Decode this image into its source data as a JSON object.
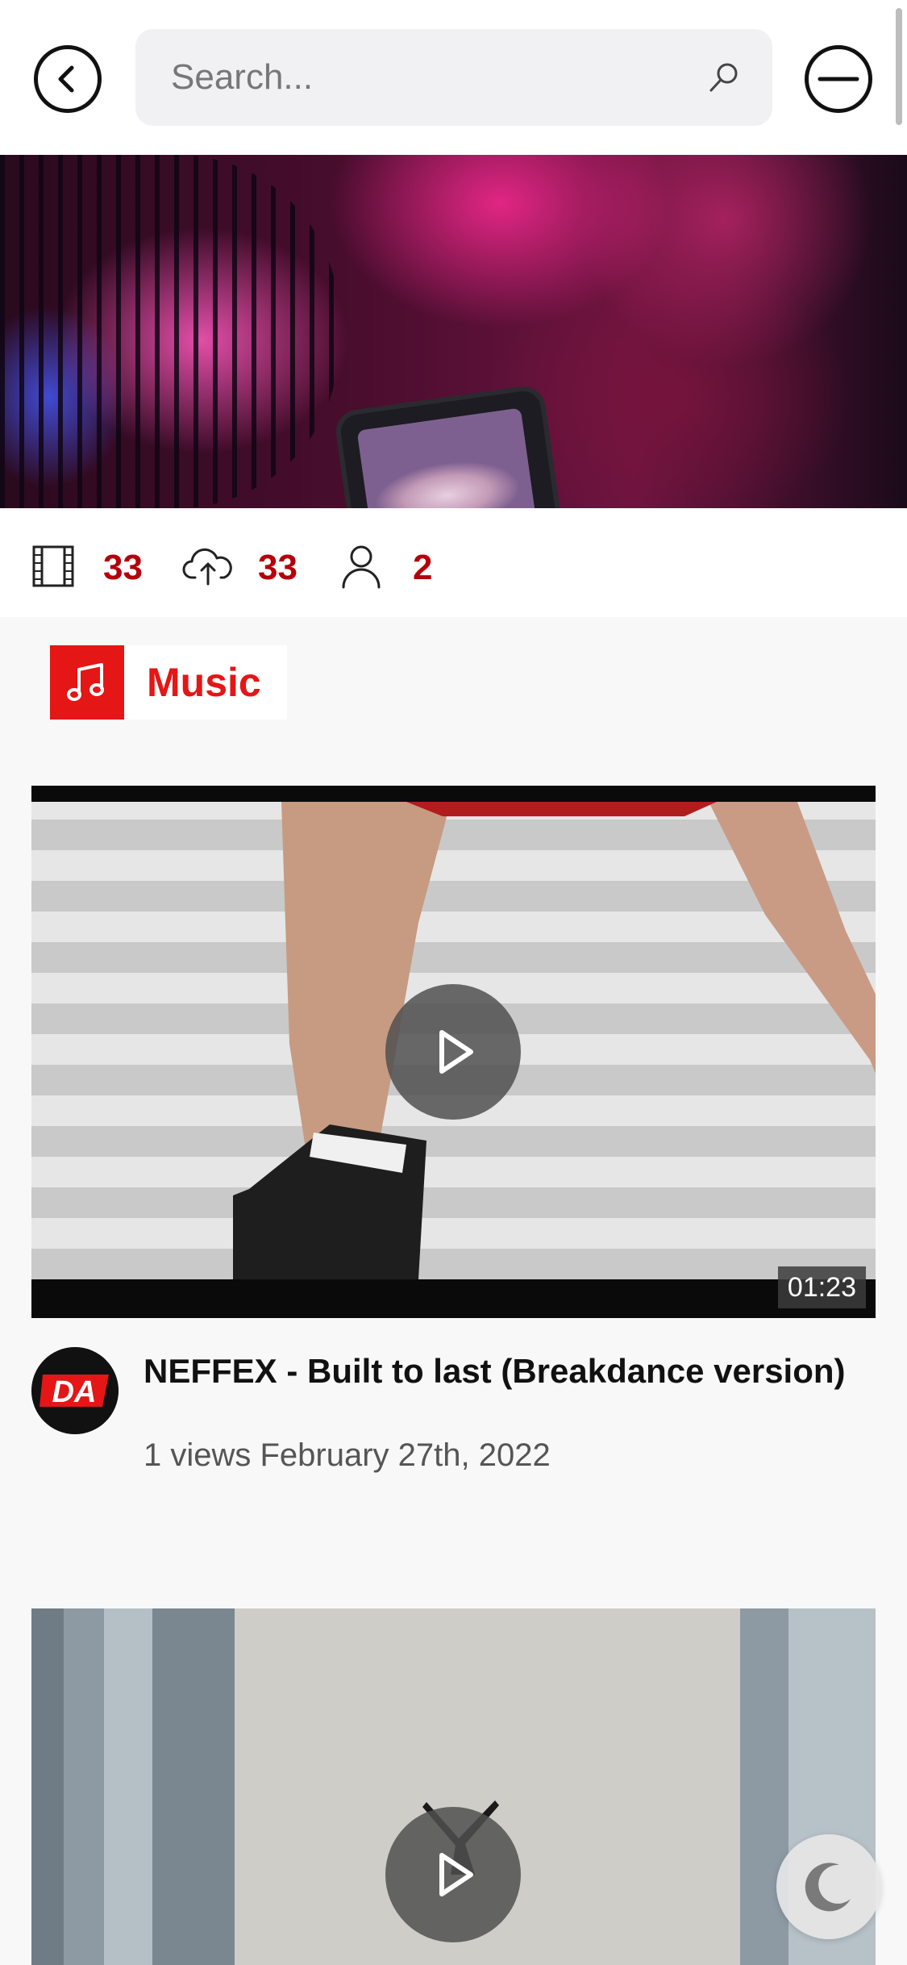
{
  "header": {
    "search_placeholder": "Search..."
  },
  "stats": {
    "videos": "33",
    "uploads": "33",
    "users": "2"
  },
  "category": {
    "label": "Music"
  },
  "videos": [
    {
      "duration": "01:23",
      "channel_avatar_text": "DA",
      "title": "NEFFEX - Built to last (Breakdance version)",
      "meta": "1 views February 27th, 2022"
    },
    {}
  ],
  "colors": {
    "accent": "#e41616",
    "stat_value": "#b3000b"
  }
}
